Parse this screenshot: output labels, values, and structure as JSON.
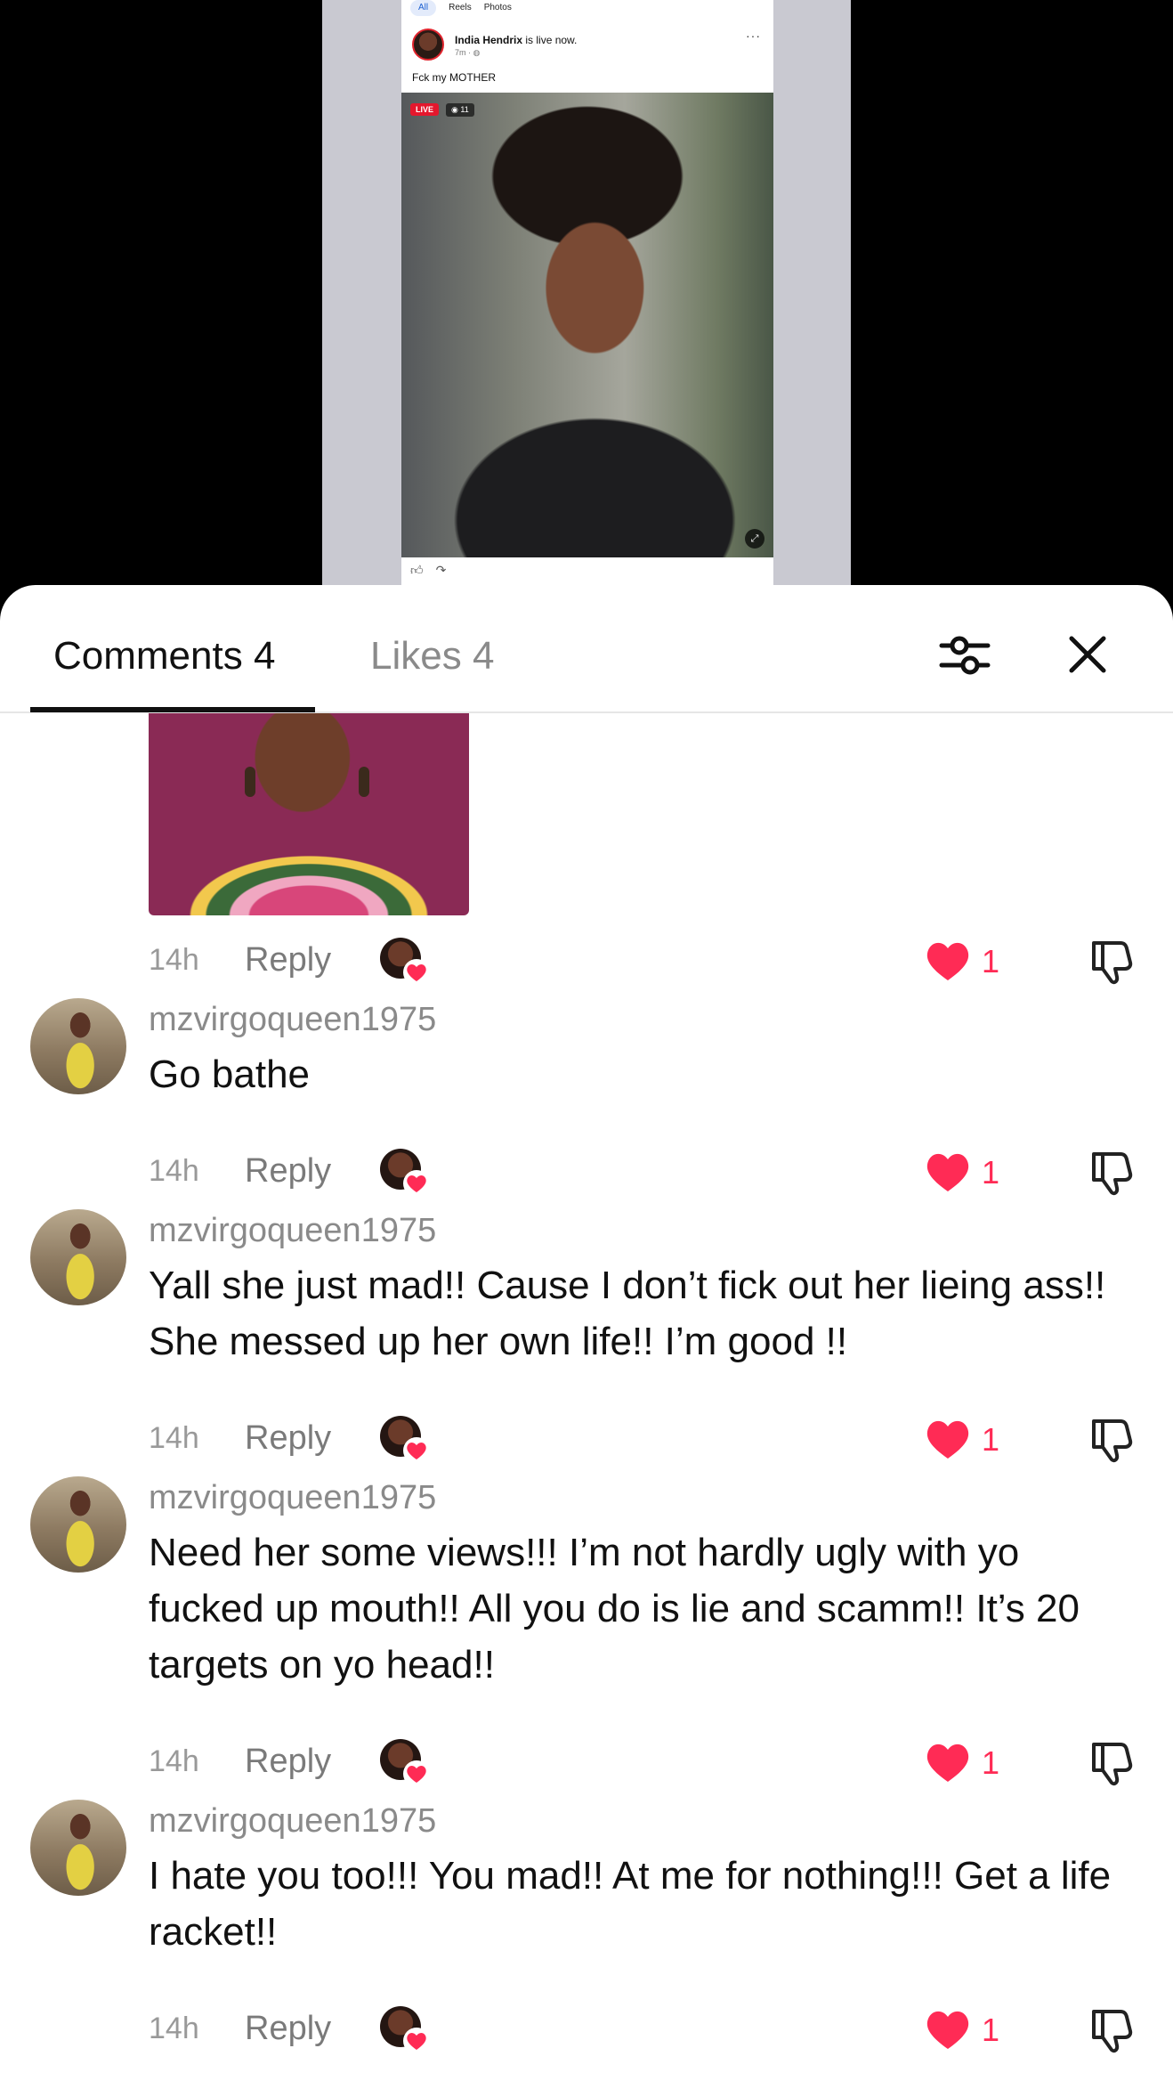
{
  "post": {
    "tabs": [
      "All",
      "Reels",
      "Photos"
    ],
    "author": "India Hendrix",
    "status": "is live now.",
    "time": "7m · ",
    "caption": "Fck my MOTHER",
    "live_label": "LIVE",
    "viewers": "11",
    "more": "···"
  },
  "sheet": {
    "tab_comments": "Comments 4",
    "tab_likes": "Likes 4"
  },
  "colors": {
    "accent_red": "#ff2b55",
    "muted_gray": "#8a8a8a"
  },
  "comments": [
    {
      "time": "14h",
      "reply": "Reply",
      "likes": "1"
    },
    {
      "user": "mzvirgoqueen1975",
      "text": "Go bathe",
      "time": "14h",
      "reply": "Reply",
      "likes": "1"
    },
    {
      "user": "mzvirgoqueen1975",
      "text": "Yall she just mad!! Cause I don’t fick out her lieing ass!! She messed up her own life!! I’m good !!",
      "time": "14h",
      "reply": "Reply",
      "likes": "1"
    },
    {
      "user": "mzvirgoqueen1975",
      "text": "Need her some views!!! I’m not hardly ugly with yo fucked up mouth!! All you do is lie and scamm!! It’s 20 targets on yo head!!",
      "time": "14h",
      "reply": "Reply",
      "likes": "1"
    },
    {
      "user": "mzvirgoqueen1975",
      "text": "I hate you too!!! You mad!! At me for nothing!!! Get a life racket!!",
      "time": "14h",
      "reply": "Reply",
      "likes": "1"
    }
  ]
}
